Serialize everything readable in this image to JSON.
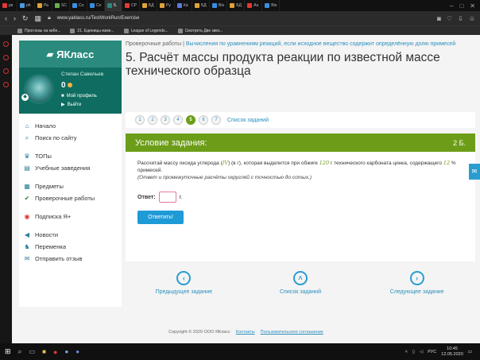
{
  "browser": {
    "tabs": [
      {
        "label": "ре",
        "color": "#e03a3a"
      },
      {
        "label": "ph",
        "color": "#4c9ae0"
      },
      {
        "label": "Ра",
        "color": "#e0a23a"
      },
      {
        "label": "SC",
        "color": "#6ab04c"
      },
      {
        "label": "Со",
        "color": "#3a8ee0"
      },
      {
        "label": "Co",
        "color": "#3a8ee0"
      },
      {
        "label": "5.",
        "color": "#2a8a7e",
        "active": true
      },
      {
        "label": "СР",
        "color": "#e03a3a"
      },
      {
        "label": "БД",
        "color": "#e0a23a"
      },
      {
        "label": "Ру",
        "color": "#e0a23a"
      },
      {
        "label": "Ка",
        "color": "#5a7ae0"
      },
      {
        "label": "БД",
        "color": "#e0a23a"
      },
      {
        "label": "Bio",
        "color": "#3a8ee0"
      },
      {
        "label": "БД",
        "color": "#e0a23a"
      },
      {
        "label": "Ан",
        "color": "#e03a3a"
      },
      {
        "label": "Bio",
        "color": "#3a8ee0"
      }
    ],
    "url": "www.yaklass.ru/TestWorkRun/Exercise",
    "bookmarks": [
      "Прогнозы на кибе...",
      "21. Единицы изме...",
      "League of Legends...",
      "Смотреть Две звез..."
    ]
  },
  "sidebar": {
    "logo": "ЯКласс",
    "profile": {
      "name": "Степан Савельев",
      "score": "0",
      "my_profile": "Мой профиль",
      "logout": "Выйти"
    },
    "groups": [
      [
        {
          "label": "Начало",
          "icon": "home-icon",
          "glyph": "⌂"
        },
        {
          "label": "Поиск по сайту",
          "icon": "search-icon",
          "glyph": "⌕"
        }
      ],
      [
        {
          "label": "ТОПы",
          "icon": "trophy-icon",
          "glyph": "♛"
        },
        {
          "label": "Учебные заведения",
          "icon": "school-icon",
          "glyph": "▤"
        }
      ],
      [
        {
          "label": "Предметы",
          "icon": "subjects-icon",
          "glyph": "▦"
        },
        {
          "label": "Проверочные работы",
          "icon": "check-icon",
          "glyph": "✔"
        }
      ],
      [
        {
          "label": "Подписка Я+",
          "icon": "subscription-icon",
          "glyph": "◉"
        }
      ],
      [
        {
          "label": "Новости",
          "icon": "news-icon",
          "glyph": "◀"
        },
        {
          "label": "Переменка",
          "icon": "break-icon",
          "glyph": "♞"
        },
        {
          "label": "Отправить отзыв",
          "icon": "feedback-icon",
          "glyph": "✉"
        }
      ]
    ]
  },
  "content": {
    "crumb_root": "Проверочные работы",
    "crumb_sep": "|",
    "crumb_link": "Вычисления по уравнениям реакций, если исходное вещество содержит определённую долю примесей",
    "title": "5. Расчёт массы продукта реакции по известной массе технического образца",
    "steps": [
      "1",
      "2",
      "3",
      "4",
      "5",
      "6",
      "7"
    ],
    "active_step": "5",
    "all_tasks": "Список заданий",
    "card": {
      "head": "Условие задания:",
      "points": "2 Б.",
      "text_1": "Рассчитай массу оксида углерода (",
      "math_iv": "IV",
      "text_2": ") (в г), которая выделится при обжиге ",
      "math_120": "120",
      "text_3": " г технического карбоната цинка, содержащего ",
      "math_12": "12",
      "text_4": " % примесей.",
      "hint": "(Ответ и промежуточные расчёты округляй с точностью до сотых.)",
      "answer_label": "Ответ:",
      "answer_value": "",
      "unit": "г.",
      "submit": "Ответить!"
    },
    "nav": {
      "prev": "Предыдущее задание",
      "list": "Список заданий",
      "next": "Следующее задание"
    },
    "footer": {
      "copyright": "Copyright © 2020 ООО ЯКласс",
      "contacts": "Контакты",
      "agreement": "Пользовательское соглашение"
    }
  },
  "taskbar": {
    "lang": "РУС",
    "time": "10:45",
    "date": "12.05.2020"
  }
}
